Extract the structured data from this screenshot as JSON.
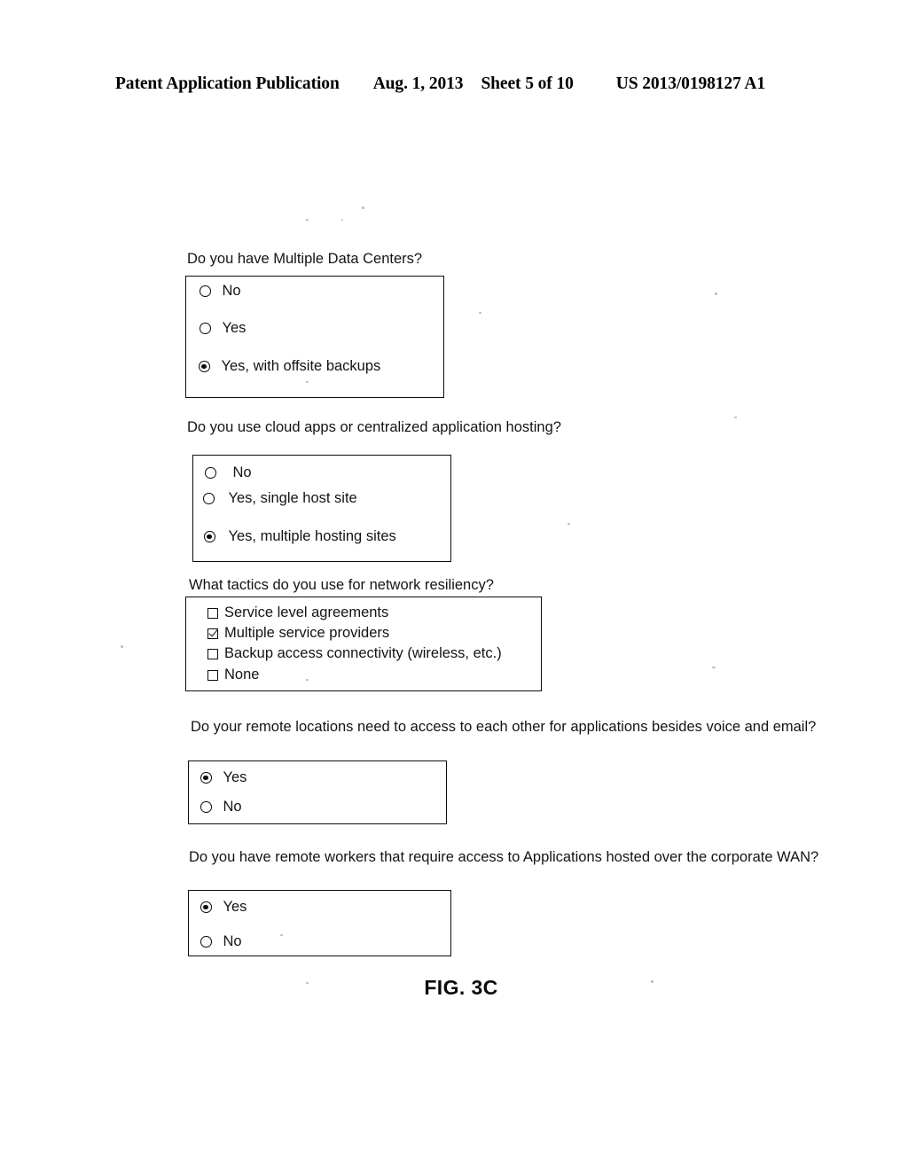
{
  "header": {
    "publication": "Patent Application Publication",
    "date": "Aug. 1, 2013",
    "sheet": "Sheet 5 of 10",
    "patent_number": "US 2013/0198127 A1"
  },
  "figure": {
    "caption": "FIG. 3C"
  },
  "questions": [
    {
      "id": "multiple-data-centers",
      "text": "Do you have Multiple Data Centers?",
      "input_type": "radio",
      "options": [
        {
          "label": "No",
          "selected": false
        },
        {
          "label": "Yes",
          "selected": false
        },
        {
          "label": "Yes, with offsite backups",
          "selected": true
        }
      ]
    },
    {
      "id": "cloud-apps-hosting",
      "text": "Do you use cloud apps or centralized application hosting?",
      "input_type": "radio",
      "options": [
        {
          "label": "No",
          "selected": false
        },
        {
          "label": "Yes, single host site",
          "selected": false
        },
        {
          "label": "Yes, multiple hosting sites",
          "selected": true
        }
      ]
    },
    {
      "id": "network-resiliency-tactics",
      "text": "What tactics do you use for network resiliency?",
      "input_type": "checkbox",
      "options": [
        {
          "label": "Service level agreements",
          "selected": false
        },
        {
          "label": "Multiple service providers",
          "selected": true
        },
        {
          "label": "Backup access connectivity (wireless, etc.)",
          "selected": false
        },
        {
          "label": "None",
          "selected": false
        }
      ]
    },
    {
      "id": "remote-locations-access",
      "text": "Do your remote locations need to access to each other for applications besides voice and email?",
      "input_type": "radio",
      "options": [
        {
          "label": "Yes",
          "selected": true
        },
        {
          "label": "No",
          "selected": false
        }
      ]
    },
    {
      "id": "remote-workers-wan",
      "text": "Do you have remote workers that require access to Applications hosted over the corporate WAN?",
      "input_type": "radio",
      "options": [
        {
          "label": "Yes",
          "selected": true
        },
        {
          "label": "No",
          "selected": false
        }
      ]
    }
  ]
}
